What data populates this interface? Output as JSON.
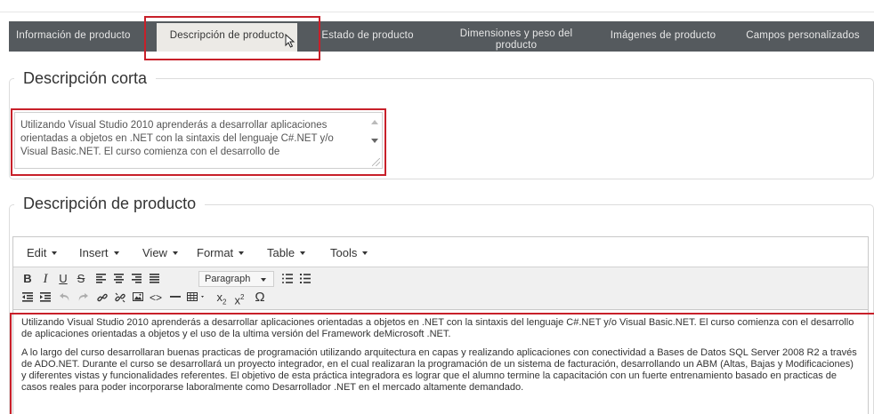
{
  "tabs": [
    {
      "label": "Información de producto",
      "active": false
    },
    {
      "label": "Descripción de producto",
      "active": true
    },
    {
      "label": "Estado de producto",
      "active": false
    },
    {
      "label": "Dimensiones y peso del producto",
      "active": false
    },
    {
      "label": "Imágenes de producto",
      "active": false
    },
    {
      "label": "Campos personalizados",
      "active": false
    }
  ],
  "short_description": {
    "legend": "Descripción corta",
    "value": "Utilizando Visual Studio 2010 aprenderás a desarrollar aplicaciones orientadas a objetos en .NET con la sintaxis del lenguaje C#.NET y/o Visual Basic.NET. El curso comienza con el desarrollo de"
  },
  "product_description": {
    "legend": "Descripción de producto",
    "menu": [
      "Edit",
      "Insert",
      "View",
      "Format",
      "Table",
      "Tools"
    ],
    "format_select": "Paragraph",
    "paragraphs": [
      "Utilizando Visual Studio 2010 aprenderás a desarrollar aplicaciones orientadas a objetos en .NET con la sintaxis del lenguaje C#.NET y/o Visual Basic.NET. El curso comienza con el desarrollo de aplicaciones orientadas a objetos y el uso de la ultima versión del Framework deMicrosoft .NET.",
      "A lo largo del curso desarrollaran buenas practicas de programación utilizando arquitectura en capas y realizando aplicaciones con conectividad a Bases de Datos SQL Server 2008 R2 a través de ADO.NET. Durante el curso se desarrollará un proyecto integrador, en el cual realizaran la programación de un sistema de facturación, desarrollando un ABM (Altas, Bajas y Modificaciones) y diferentes vistas y funcionalidades referentes. El objetivo de esta práctica integradora es lograr que el alumno termine la capacitación con un fuerte entrenamiento basado en practicas de casos reales para poder incorporarse laboralmente como Desarrollador .NET en el mercado altamente demandado."
    ]
  },
  "toolbar_icons": {
    "row1": [
      "bold-icon",
      "italic-icon",
      "underline-icon",
      "strikethrough-icon",
      "align-left-icon",
      "align-center-icon",
      "align-right-icon",
      "align-justify-icon",
      "bullet-list-icon",
      "numbered-list-icon"
    ],
    "row2": [
      "outdent-icon",
      "indent-icon",
      "undo-icon",
      "redo-icon",
      "link-icon",
      "unlink-icon",
      "image-icon",
      "code-icon",
      "horizontal-rule-icon",
      "table-icon",
      "subscript-icon",
      "superscript-icon",
      "special-character-icon"
    ]
  },
  "colors": {
    "tabbar": "#555a5e",
    "active_tab": "#eceae6",
    "highlight": "#c8202a"
  }
}
